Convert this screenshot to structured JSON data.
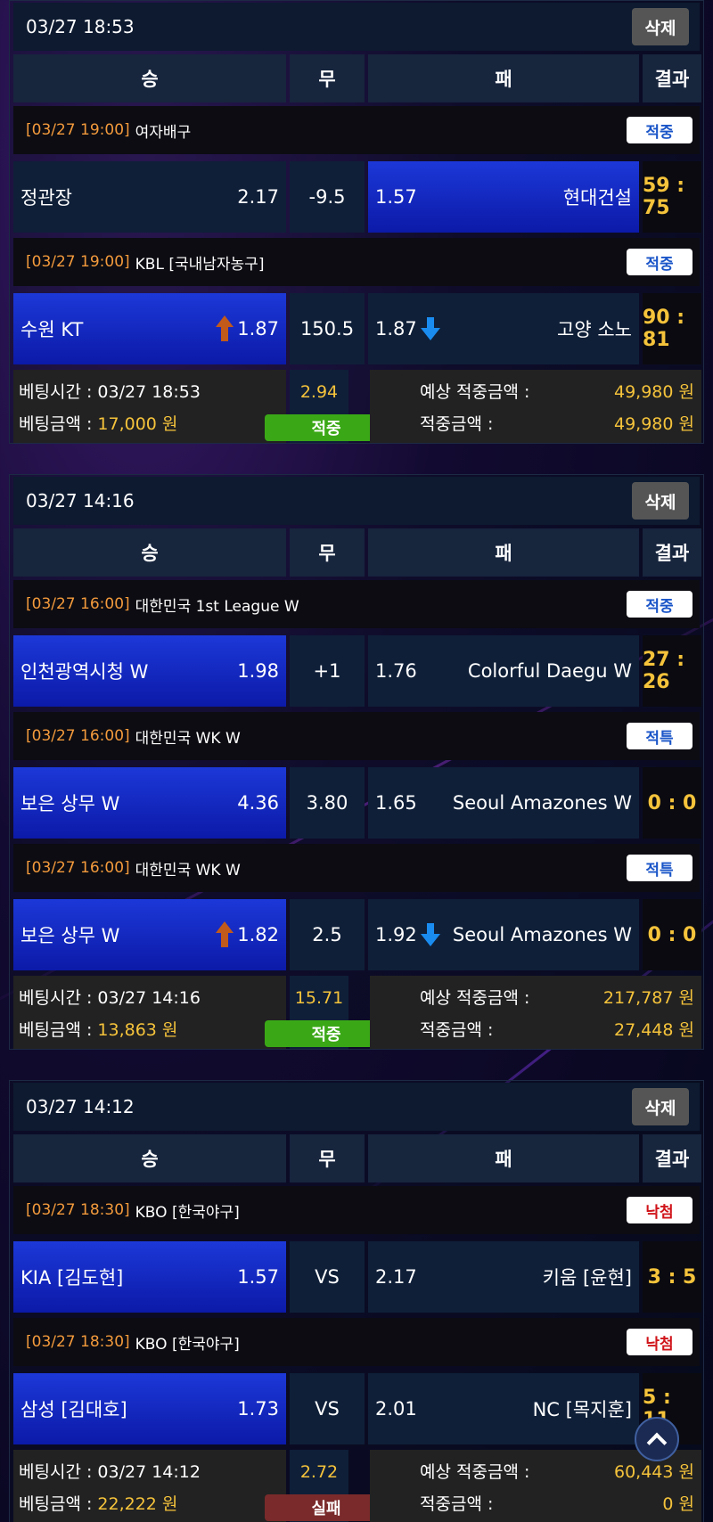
{
  "columns": {
    "win": "승",
    "draw": "무",
    "lose": "패",
    "result": "결과"
  },
  "labels": {
    "delete": "삭제",
    "bet_time": "베팅시간 : ",
    "bet_amount": "베팅금액 : ",
    "expected_win": "예상 적중금액 :",
    "win_amount": "적중금액 :"
  },
  "slips": [
    {
      "time": "03/27 18:53",
      "games": [
        {
          "game_time": "[03/27 19:00]",
          "league": "여자배구",
          "badge": "적중",
          "home": "정관장",
          "home_odd": "2.17",
          "mid": "-9.5",
          "away_odd": "1.57",
          "away": "현대건설",
          "score": "59 : 75"
        },
        {
          "game_time": "[03/27 19:00]",
          "league": "KBL [국내남자농구]",
          "badge": "적중",
          "home": "수원 KT",
          "home_odd": "1.87",
          "mid": "150.5",
          "away_odd": "1.87",
          "away": "고양 소노",
          "score": "90 : 81"
        }
      ],
      "bet_time": "03/27 18:53",
      "bet_amount": "17,000 원",
      "total_odds": "2.94",
      "status": "적중",
      "expected": "49,980 원",
      "won": "49,980 원"
    },
    {
      "time": "03/27 14:16",
      "games": [
        {
          "game_time": "[03/27 16:00]",
          "league": "대한민국 1st League W",
          "badge": "적중",
          "home": "인천광역시청 W",
          "home_odd": "1.98",
          "mid": "+1",
          "away_odd": "1.76",
          "away": "Colorful Daegu W",
          "score": "27 : 26"
        },
        {
          "game_time": "[03/27 16:00]",
          "league": "대한민국 WK W",
          "badge": "적특",
          "home": "보은 상무 W",
          "home_odd": "4.36",
          "mid": "3.80",
          "away_odd": "1.65",
          "away": "Seoul Amazones W",
          "score": "0 : 0"
        },
        {
          "game_time": "[03/27 16:00]",
          "league": "대한민국 WK W",
          "badge": "적특",
          "home": "보은 상무 W",
          "home_odd": "1.82",
          "mid": "2.5",
          "away_odd": "1.92",
          "away": "Seoul Amazones W",
          "score": "0 : 0"
        }
      ],
      "bet_time": "03/27 14:16",
      "bet_amount": "13,863 원",
      "total_odds": "15.71",
      "status": "적중",
      "expected": "217,787 원",
      "won": "27,448 원"
    },
    {
      "time": "03/27 14:12",
      "games": [
        {
          "game_time": "[03/27 18:30]",
          "league": "KBO [한국야구]",
          "badge": "낙첨",
          "home": "KIA [김도현]",
          "home_odd": "1.57",
          "mid": "VS",
          "away_odd": "2.17",
          "away": "키움 [윤현]",
          "score": "3 : 5"
        },
        {
          "game_time": "[03/27 18:30]",
          "league": "KBO [한국야구]",
          "badge": "낙첨",
          "home": "삼성 [김대호]",
          "home_odd": "1.73",
          "mid": "VS",
          "away_odd": "2.01",
          "away": "NC [목지훈]",
          "score": "5 : 11"
        }
      ],
      "bet_time": "03/27 14:12",
      "bet_amount": "22,222 원",
      "total_odds": "2.72",
      "status": "실패",
      "expected": "60,443 원",
      "won": "0 원"
    }
  ]
}
